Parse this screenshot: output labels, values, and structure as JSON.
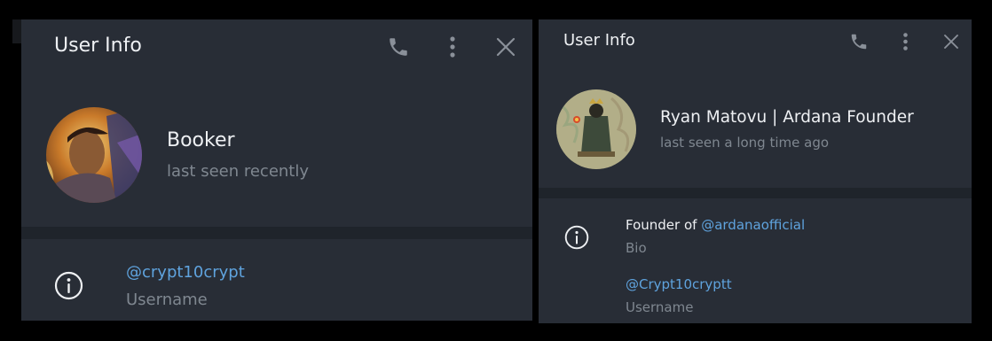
{
  "left_panel": {
    "title": "User Info",
    "header_icons": [
      "phone-icon",
      "more-vertical-icon",
      "close-icon"
    ],
    "profile": {
      "name": "Booker",
      "status": "last seen recently"
    },
    "info": {
      "username_value": "@crypt10crypt",
      "username_label": "Username"
    }
  },
  "right_panel": {
    "title": "User Info",
    "header_icons": [
      "phone-icon",
      "more-vertical-icon",
      "close-icon"
    ],
    "profile": {
      "name": "Ryan Matovu | Ardana Founder",
      "status": "last seen a long time ago"
    },
    "info": {
      "bio_prefix": "Founder of ",
      "bio_mention": "@ardanaofficial",
      "bio_label": "Bio",
      "username_value": "@Crypt10cryptt",
      "username_label": "Username"
    }
  },
  "colors": {
    "panel_bg": "#282d36",
    "divider": "#1f242b",
    "text_primary": "#eef0f3",
    "text_secondary": "#7f8790",
    "link": "#5fa3de",
    "icon": "#8a9099"
  }
}
